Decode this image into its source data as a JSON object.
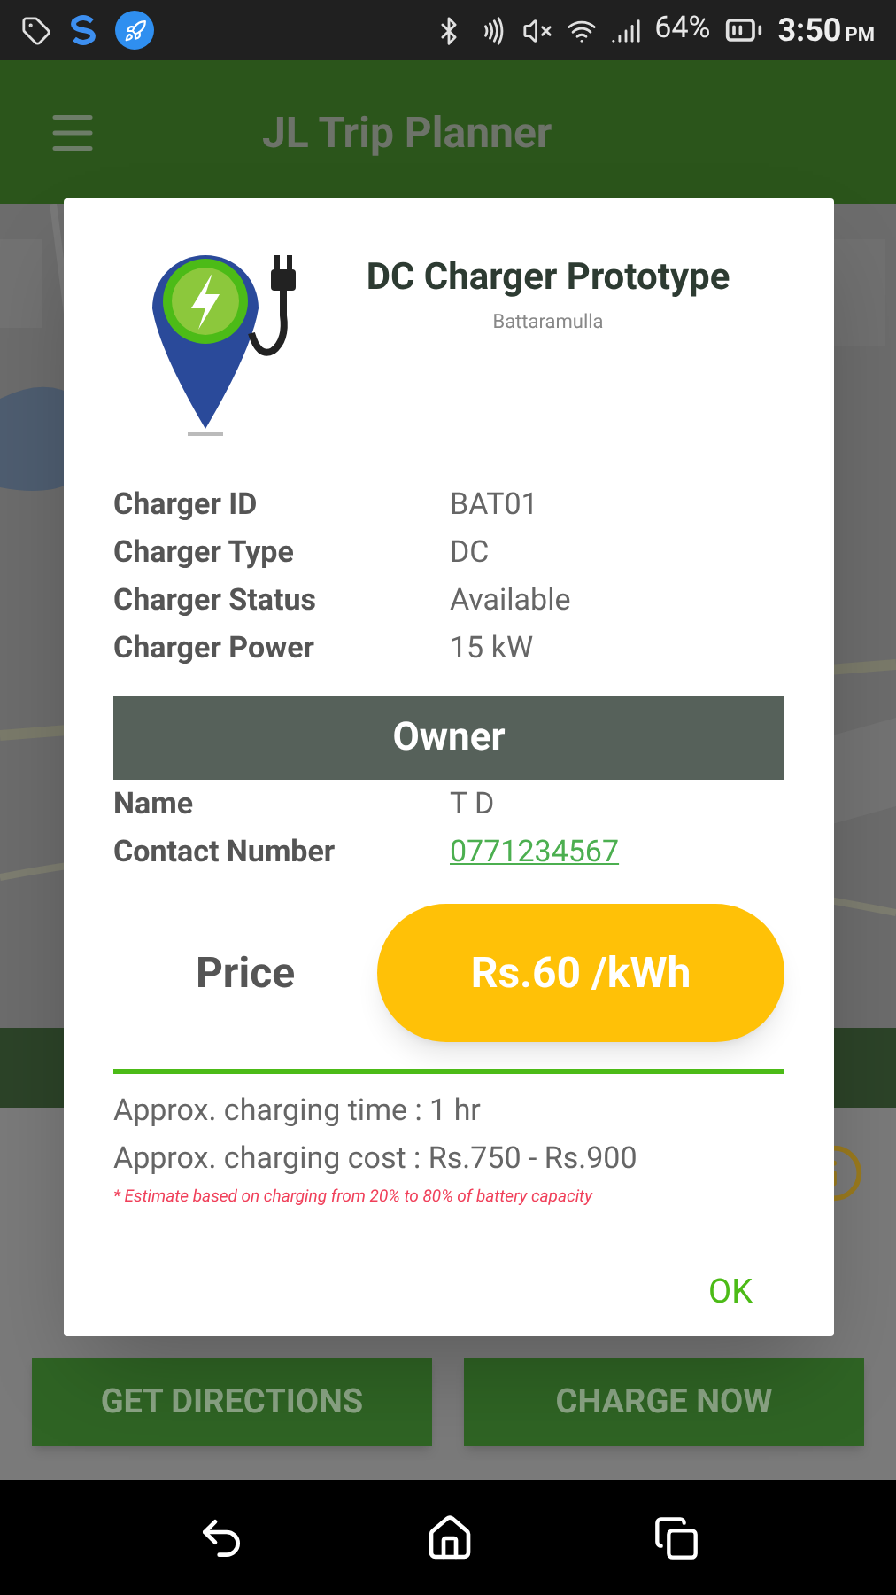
{
  "status_bar": {
    "battery": "64%",
    "time": "3:50",
    "time_suffix": "PM"
  },
  "app_bar": {
    "title": "JL Trip Planner"
  },
  "dialog": {
    "title": "DC Charger Prototype",
    "subtitle": "Battaramulla",
    "details": [
      {
        "label": "Charger ID",
        "value": "BAT01"
      },
      {
        "label": "Charger Type",
        "value": "DC"
      },
      {
        "label": "Charger Status",
        "value": "Available"
      },
      {
        "label": "Charger Power",
        "value": "15 kW"
      }
    ],
    "owner_heading": "Owner",
    "owner": [
      {
        "label": "Name",
        "value": "T D",
        "kind": "text"
      },
      {
        "label": "Contact Number",
        "value": "0771234567",
        "kind": "link"
      }
    ],
    "price_label": "Price",
    "price": "Rs.60 /kWh",
    "estimates": [
      "Approx. charging time : 1 hr",
      "Approx. charging cost : Rs.750 - Rs.900"
    ],
    "footnote": "* Estimate based on charging from 20% to 80% of battery capacity",
    "ok": "OK"
  },
  "bottom_buttons": [
    "GET DIRECTIONS",
    "CHARGE NOW"
  ]
}
